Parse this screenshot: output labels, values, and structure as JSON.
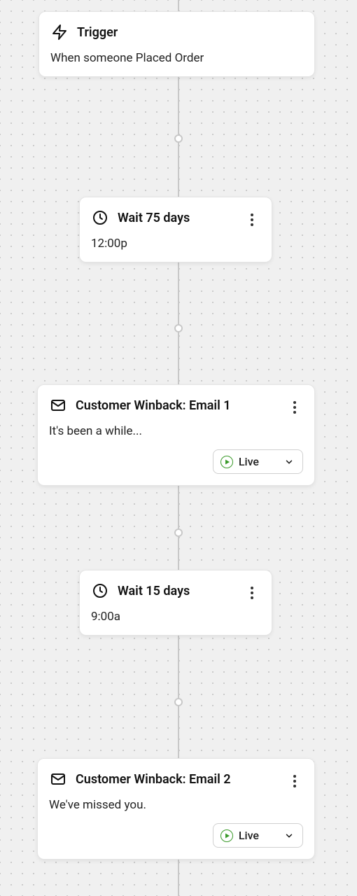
{
  "trigger": {
    "title": "Trigger",
    "description": "When someone Placed Order"
  },
  "wait1": {
    "title": "Wait 75 days",
    "time": "12:00p"
  },
  "email1": {
    "title": "Customer Winback: Email 1",
    "subject": "It's been a while...",
    "status": "Live"
  },
  "wait2": {
    "title": "Wait 15 days",
    "time": "9:00a"
  },
  "email2": {
    "title": "Customer Winback: Email 2",
    "subject": "We've missed you.",
    "status": "Live"
  }
}
